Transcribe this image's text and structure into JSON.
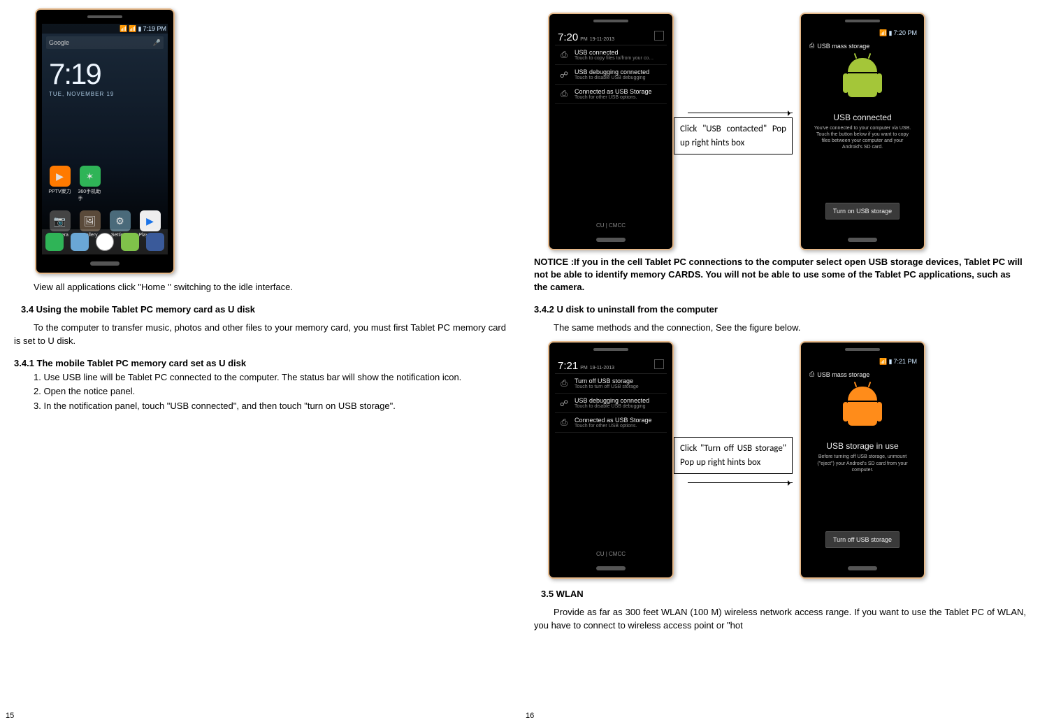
{
  "pages": {
    "left": "15",
    "right": "16"
  },
  "left": {
    "home": {
      "status_time": "7:19 PM",
      "google": "Google",
      "clock_time": "7:19",
      "clock_date": "TUE, NOVEMBER 19",
      "row1": [
        {
          "label": "PPTV聚力",
          "icon": "▶",
          "bg": "#ff7a00"
        },
        {
          "label": "360手机助手",
          "icon": "✶",
          "bg": "#2fb457"
        }
      ],
      "row2": [
        {
          "label": "Camera",
          "icon": "📷",
          "bg": "#444"
        },
        {
          "label": "Gallery",
          "icon": "🖼",
          "bg": "#5a4a3a"
        },
        {
          "label": "Settings",
          "icon": "⚙",
          "bg": "#4a6a7a"
        },
        {
          "label": "Play Store",
          "icon": "▶",
          "bg": "#eee"
        }
      ]
    },
    "caption1": "View all applications click \"Home \" switching to the idle interface.",
    "h34": "3.4    Using the mobile Tablet PC memory card as U disk",
    "p34": "To the computer to transfer music, photos and other files to your memory card, you must first Tablet PC memory card is set to U disk.",
    "h341": "3.4.1    The mobile Tablet PC memory card set as U disk",
    "li1": "1. Use USB line will be Tablet PC connected to the computer. The status bar will show the notification icon.",
    "li2": "2. Open the notice panel.",
    "li3": "3. In the notification panel, touch \"USB connected\", and then touch \"turn on USB storage\"."
  },
  "right": {
    "notif1": {
      "time_big": "7:20",
      "time_ampm": "PM",
      "time_date": "19-11-2013",
      "items": [
        {
          "icon": "⎙",
          "t1": "USB connected",
          "t2": "Touch to copy files to/from your co…"
        },
        {
          "icon": "☍",
          "t1": "USB debugging connected",
          "t2": "Touch to disable USB debugging"
        },
        {
          "icon": "⎙",
          "t1": "Connected as USB Storage",
          "t2": "Touch for other USB options."
        }
      ],
      "footer": "CU  |  CMCC"
    },
    "callout1": "Click \"USB contacted\" Pop up right hints box",
    "usb1": {
      "status_time": "7:20 PM",
      "crumb": "USB mass storage",
      "heading": "USB connected",
      "body": "You've connected to your computer via USB. Touch the button below if you want to copy files between your computer and your Android's SD card.",
      "button": "Turn on USB storage"
    },
    "notice": "NOTICE :If you in the cell Tablet PC connections to the computer select open USB storage devices, Tablet PC will not be able to identify memory CARDS. You will not be able to use some of the Tablet PC applications, such as the camera.",
    "h342": "3.4.2    U disk to uninstall from the computer",
    "p342": "The same methods and the connection, See the figure below.",
    "notif2": {
      "time_big": "7:21",
      "time_ampm": "PM",
      "time_date": "19-11-2013",
      "items": [
        {
          "icon": "⎙",
          "t1": "Turn off USB storage",
          "t2": "Touch to turn off USB storage"
        },
        {
          "icon": "☍",
          "t1": "USB debugging connected",
          "t2": "Touch to disable USB debugging"
        },
        {
          "icon": "⎙",
          "t1": "Connected as USB Storage",
          "t2": "Touch for other USB options."
        }
      ],
      "footer": "CU  |  CMCC"
    },
    "callout2": "Click \"Turn off USB storage\" Pop up right hints box",
    "usb2": {
      "status_time": "7:21 PM",
      "crumb": "USB mass storage",
      "heading": "USB storage in use",
      "body": "Before turning off USB storage, unmount (\"eject\") your Android's SD card from your computer.",
      "button": "Turn off USB storage"
    },
    "h35": "3.5    WLAN",
    "p35": "Provide as far as 300 feet WLAN (100 M) wireless network access range. If you want to use the Tablet PC of WLAN, you have to connect to wireless access point or \"hot"
  }
}
